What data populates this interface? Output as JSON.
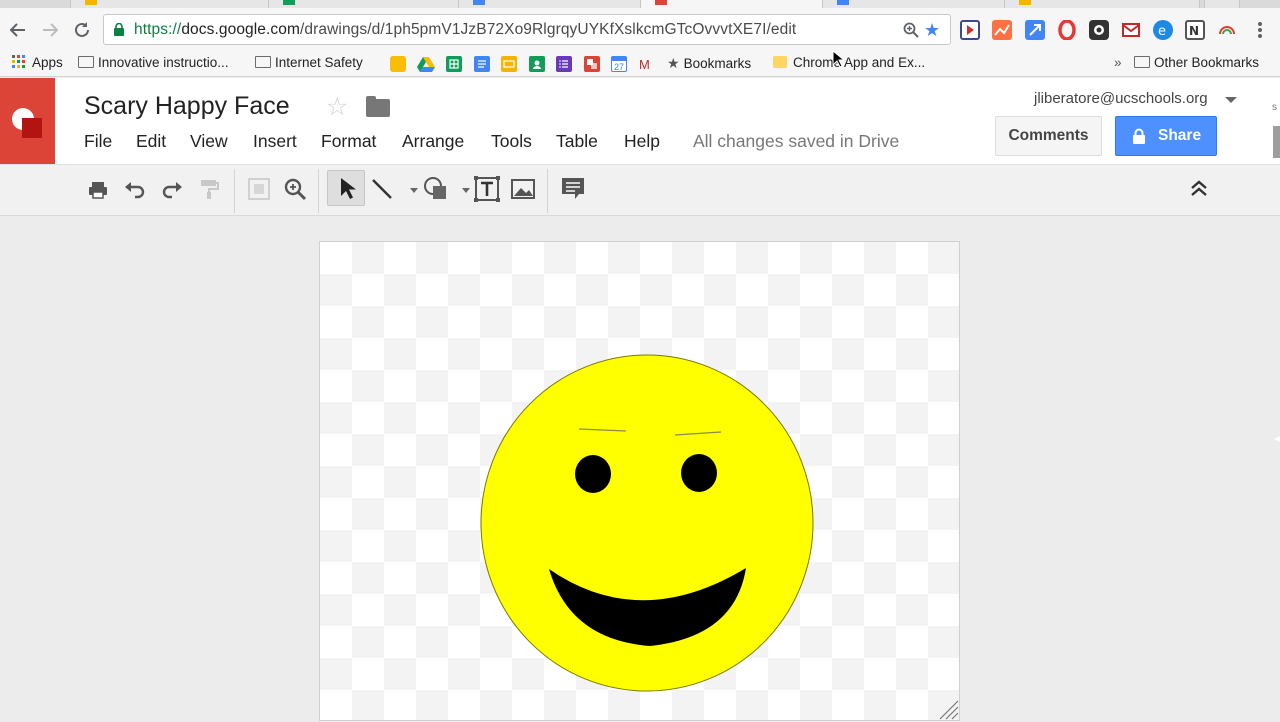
{
  "browser": {
    "url_proto": "https://",
    "url_host": "docs.google.com",
    "url_path": "/drawings/d/1ph5pmV1JzB72Xo9RlgrqyUYKfXslkcmGTcOvvvtXE7I/edit",
    "bookmarks": {
      "apps": "Apps",
      "innovative": "Innovative instructio...",
      "internet_safety": "Internet Safety",
      "bookmarks_label": "Bookmarks",
      "chrome_apps": "Chrome App and Ex...",
      "overflow": "»",
      "other": "Other Bookmarks",
      "calendar_day": "27",
      "gmail": "M"
    }
  },
  "doc": {
    "title": "Scary Happy Face",
    "menu": [
      "File",
      "Edit",
      "View",
      "Insert",
      "Format",
      "Arrange",
      "Tools",
      "Table",
      "Help"
    ],
    "status": "All changes saved in Drive",
    "account": "jliberatore@ucschools.org",
    "comments_label": "Comments",
    "share_label": "Share"
  },
  "colors": {
    "brand_red": "#db4437",
    "share_blue": "#4d90fe",
    "face_fill": "#ffff00",
    "feature_fill": "#000000"
  },
  "icons": [
    "print-icon",
    "undo-icon",
    "redo-icon",
    "paint-format-icon",
    "zoom-fit-icon",
    "zoom-icon",
    "select-icon",
    "line-icon",
    "shape-icon",
    "text-box-icon",
    "image-icon",
    "comment-icon",
    "collapse-icon"
  ]
}
